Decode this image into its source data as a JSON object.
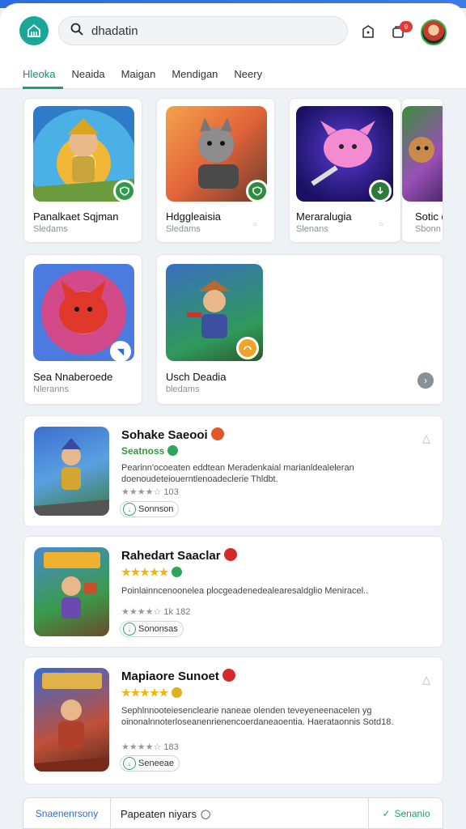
{
  "header": {
    "search_value": "dhadatin",
    "notification_count": "9"
  },
  "tabs": [
    "Hleoka",
    "Neaida",
    "Maigan",
    "Mendigan",
    "Neery"
  ],
  "grid": [
    {
      "title": "Panalkaet Sqjman",
      "subtitle": "Sledams"
    },
    {
      "title": "Hdggleaisia",
      "subtitle": "Sledams"
    },
    {
      "title": "Meraralugia",
      "subtitle": "Slenans"
    },
    {
      "title": "Sotic d",
      "subtitle": "Sbonn"
    },
    {
      "title": "Sea Nnaberoede",
      "subtitle": "Nleranns"
    },
    {
      "title": "Usch Deadia",
      "subtitle": "bledams"
    }
  ],
  "list": [
    {
      "title": "Sohake Saeooi",
      "subtitle": "Seatnoss",
      "desc": "Pearinn'ocoeaten eddtean Meradenkaial marianldealeleran doenoudeteiouerntlenoadeclerie Thldbt.",
      "rating": "103",
      "pill": "Sonnson"
    },
    {
      "title": "Rahedart Saaclar",
      "subtitle": "",
      "desc": "Poinlainncenoonelea plocgeadenedealearesaldglio Meniracel..",
      "rating": "1k 182",
      "pill": "Sononsas"
    },
    {
      "title": "Mapiaore Sunoet",
      "subtitle": "",
      "desc": "Sephlnnooteiesenclearie naneae olenden teveyeneenacelen yg oinonalnnoterloseanenrienencoerdaneaoentia. Haerataonnis Sotd18.",
      "rating": "183",
      "pill": "Seneeae"
    }
  ],
  "bottom": {
    "left_label": "Snaenenrsony",
    "middle_label": "Papeaten niyars",
    "right_label": "Senanio"
  },
  "colors": {
    "accent": "#1aa37a",
    "brand": "#2d6cdf",
    "rating_gold": "#f5b50a"
  }
}
